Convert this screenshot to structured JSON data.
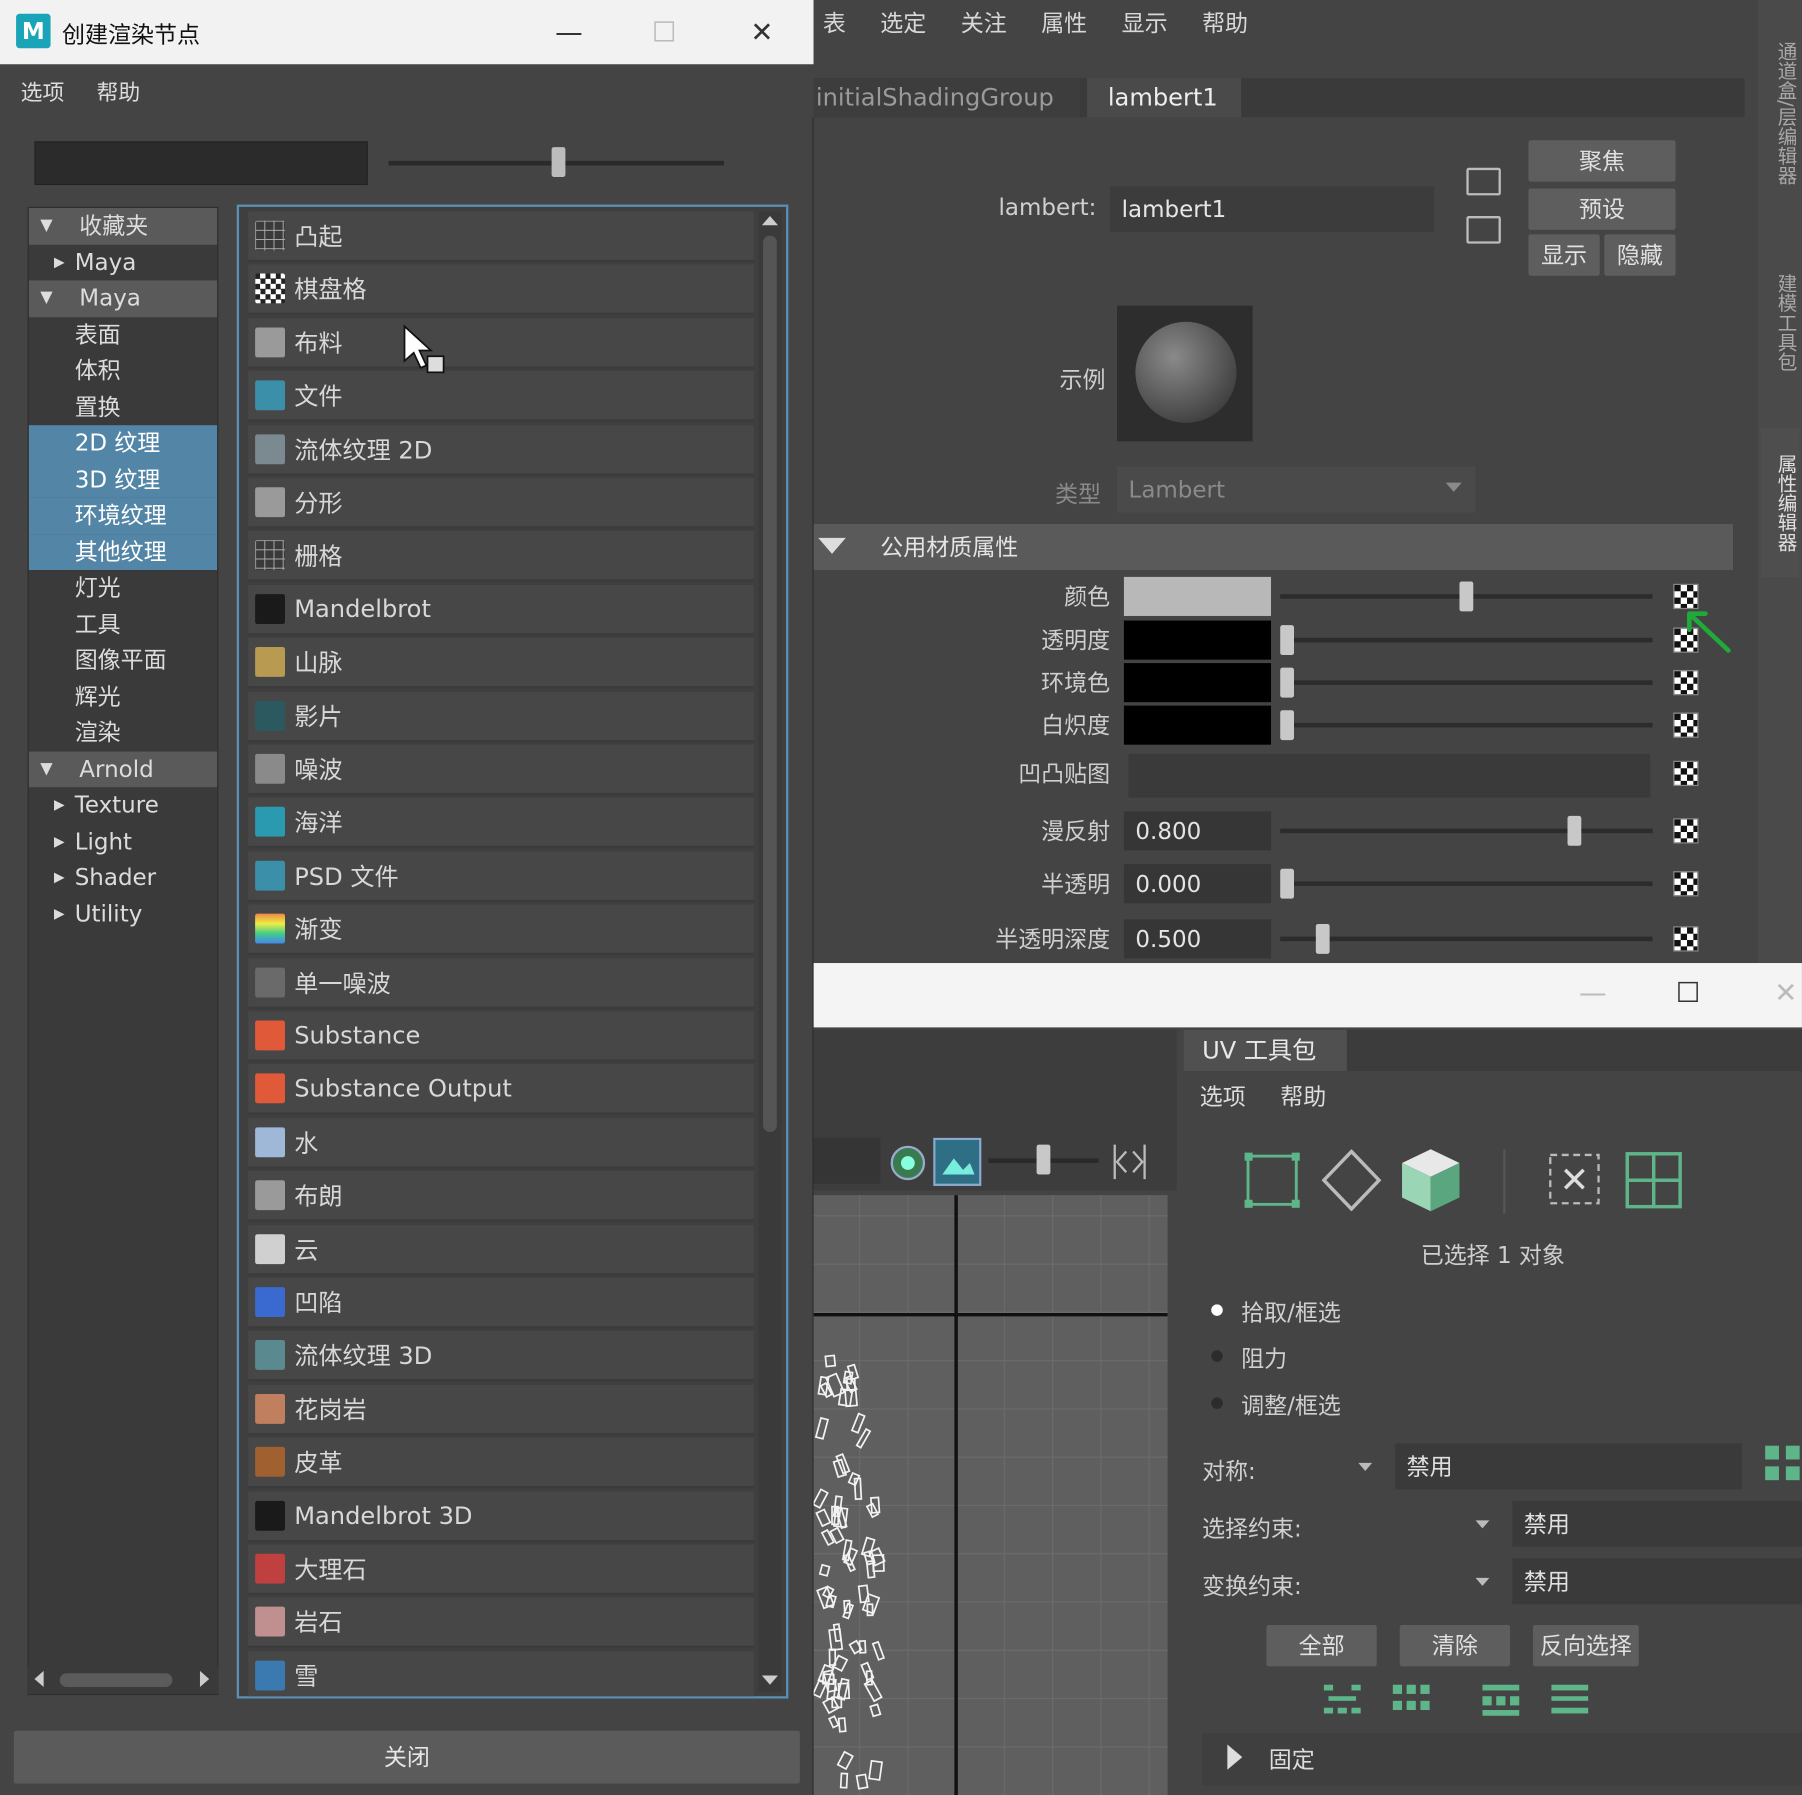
{
  "create_render_node": {
    "title": "创建渲染节点",
    "logo": "M",
    "window_controls": {
      "minimize": "—",
      "maximize": "☐",
      "close": "✕"
    },
    "menu": [
      "选项",
      "帮助"
    ],
    "categories": [
      {
        "label": "收藏夹",
        "kind": "group"
      },
      {
        "label": "Maya",
        "kind": "exp"
      },
      {
        "label": "Maya",
        "kind": "group"
      },
      {
        "label": "表面",
        "kind": "sub"
      },
      {
        "label": "体积",
        "kind": "sub"
      },
      {
        "label": "置换",
        "kind": "sub"
      },
      {
        "label": "2D 纹理",
        "kind": "sub",
        "selected": true
      },
      {
        "label": "3D 纹理",
        "kind": "sub",
        "selected": true
      },
      {
        "label": "环境纹理",
        "kind": "sub",
        "selected": true
      },
      {
        "label": "其他纹理",
        "kind": "sub",
        "selected": true
      },
      {
        "label": "灯光",
        "kind": "sub"
      },
      {
        "label": "工具",
        "kind": "sub"
      },
      {
        "label": "图像平面",
        "kind": "sub"
      },
      {
        "label": "辉光",
        "kind": "sub"
      },
      {
        "label": "渲染",
        "kind": "sub"
      },
      {
        "label": "Arnold",
        "kind": "group"
      },
      {
        "label": "Texture",
        "kind": "exp"
      },
      {
        "label": "Light",
        "kind": "exp"
      },
      {
        "label": "Shader",
        "kind": "exp"
      },
      {
        "label": "Utility",
        "kind": "exp"
      }
    ],
    "nodes": [
      {
        "label": "凸起",
        "icon": "bulge-icon",
        "color": "#6a6a6a"
      },
      {
        "label": "棋盘格",
        "icon": "checker-icon",
        "color": "#8a8a8a"
      },
      {
        "label": "布料",
        "icon": "cloth-icon",
        "color": "#9a9a9a"
      },
      {
        "label": "文件",
        "icon": "file-icon",
        "color": "#3b8fa8"
      },
      {
        "label": "流体纹理 2D",
        "icon": "fluid-texture-2d-icon",
        "color": "#7a8a90"
      },
      {
        "label": "分形",
        "icon": "fractal-icon",
        "color": "#9a9a9a"
      },
      {
        "label": "栅格",
        "icon": "grid-icon",
        "color": "#6a6a6a"
      },
      {
        "label": "Mandelbrot",
        "icon": "mandelbrot-icon",
        "color": "#1a1a1a"
      },
      {
        "label": "山脉",
        "icon": "mountain-icon",
        "color": "#b89a50"
      },
      {
        "label": "影片",
        "icon": "movie-icon",
        "color": "#2c5860"
      },
      {
        "label": "噪波",
        "icon": "noise-icon",
        "color": "#8a8a8a"
      },
      {
        "label": "海洋",
        "icon": "ocean-icon",
        "color": "#2a9ab0"
      },
      {
        "label": "PSD 文件",
        "icon": "psd-file-icon",
        "color": "#3b8fa8"
      },
      {
        "label": "渐变",
        "icon": "ramp-icon",
        "color": "#e0a030"
      },
      {
        "label": "单一噪波",
        "icon": "simplex-noise-icon",
        "color": "#6a6a6a"
      },
      {
        "label": "Substance",
        "icon": "substance-icon",
        "color": "#e05a3a"
      },
      {
        "label": "Substance Output",
        "icon": "substance-output-icon",
        "color": "#e05a3a"
      },
      {
        "label": "水",
        "icon": "water-icon",
        "color": "#a0b8d8"
      },
      {
        "label": "布朗",
        "icon": "brownian-icon",
        "color": "#9a9a9a"
      },
      {
        "label": "云",
        "icon": "cloud-icon",
        "color": "#d0d0d0"
      },
      {
        "label": "凹陷",
        "icon": "crater-icon",
        "color": "#3a6ad0"
      },
      {
        "label": "流体纹理 3D",
        "icon": "fluid-texture-3d-icon",
        "color": "#5a8a90"
      },
      {
        "label": "花岗岩",
        "icon": "granite-icon",
        "color": "#c08060"
      },
      {
        "label": "皮革",
        "icon": "leather-icon",
        "color": "#a06030"
      },
      {
        "label": "Mandelbrot 3D",
        "icon": "mandelbrot-3d-icon",
        "color": "#1a1a1a"
      },
      {
        "label": "大理石",
        "icon": "marble-icon",
        "color": "#c04040"
      },
      {
        "label": "岩石",
        "icon": "rock-icon",
        "color": "#c09090"
      },
      {
        "label": "雪",
        "icon": "snow-icon",
        "color": "#3a7ab0"
      }
    ],
    "close_button": "关闭"
  },
  "attribute_editor": {
    "menu": [
      "表",
      "选定",
      "关注",
      "属性",
      "显示",
      "帮助"
    ],
    "tabs": [
      "initialShadingGroup",
      "lambert1"
    ],
    "active_tab": "lambert1",
    "name_label": "lambert:",
    "name_value": "lambert1",
    "buttons": {
      "focus": "聚焦",
      "presets": "预设",
      "show": "显示",
      "hide": "隐藏"
    },
    "sample_label": "示例",
    "type_label": "类型",
    "type_value": "Lambert",
    "section_title": "公用材质属性",
    "attributes": [
      {
        "label": "颜色",
        "kind": "color",
        "color": "#b8b8b8",
        "slider": 0.5
      },
      {
        "label": "透明度",
        "kind": "color",
        "color": "#000000",
        "slider": 0.0
      },
      {
        "label": "环境色",
        "kind": "color",
        "color": "#000000",
        "slider": 0.0
      },
      {
        "label": "白炽度",
        "kind": "color",
        "color": "#000000",
        "slider": 0.0
      },
      {
        "label": "凹凸贴图",
        "kind": "map"
      },
      {
        "label": "漫反射",
        "kind": "number",
        "value": "0.800",
        "slider": 0.8
      },
      {
        "label": "半透明",
        "kind": "number",
        "value": "0.000",
        "slider": 0.0
      },
      {
        "label": "半透明深度",
        "kind": "number",
        "value": "0.500",
        "slider": 0.1
      }
    ],
    "side_tabs": [
      "通道盒/层编辑器",
      "建模工具包",
      "属性编辑器"
    ],
    "accent_arrow_color": "#1faa3a"
  },
  "uv_editor": {
    "window_controls": {
      "minimize": "—",
      "maximize": "☐",
      "close": "✕"
    },
    "tab": "UV 工具包",
    "menu": [
      "选项",
      "帮助"
    ],
    "selection_count": "已选择 1 对象",
    "pick_modes": [
      {
        "label": "拾取/框选",
        "on": true
      },
      {
        "label": "阻力",
        "on": false
      },
      {
        "label": "调整/框选",
        "on": false
      }
    ],
    "symmetry": {
      "label": "对称:",
      "value": "禁用"
    },
    "selection_constraint": {
      "label": "选择约束:",
      "value": "禁用"
    },
    "transform_constraint": {
      "label": "变换约束:",
      "value": "禁用"
    },
    "buttons": {
      "all": "全部",
      "clear": "清除",
      "invert": "反向选择"
    },
    "pin_section": "固定"
  }
}
